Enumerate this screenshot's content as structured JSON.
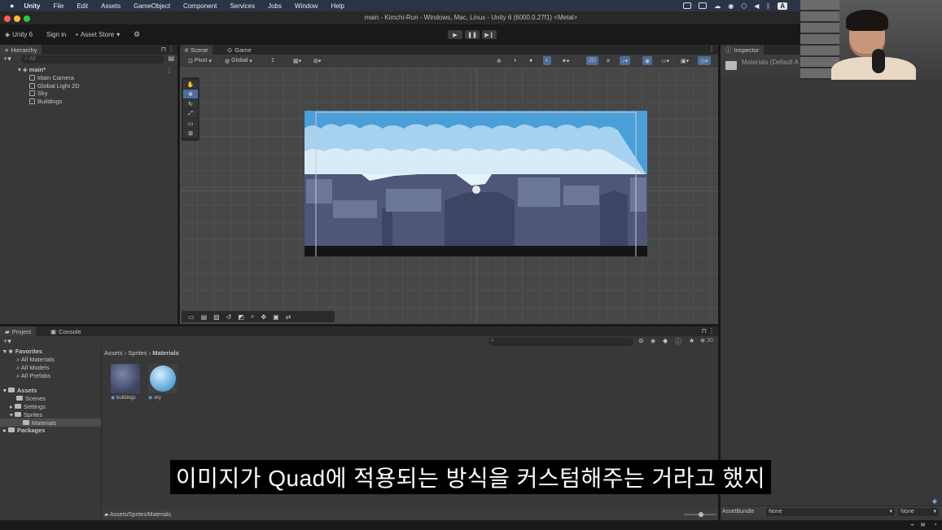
{
  "menubar": {
    "app": "Unity",
    "items": [
      "File",
      "Edit",
      "Assets",
      "GameObject",
      "Component",
      "Services",
      "Jobs",
      "Window",
      "Help"
    ],
    "badge": "A"
  },
  "window": {
    "title": "main - Kimchi-Run - Windows, Mac, Linux - Unity 6 (6000.0.27f1) <Metal>"
  },
  "toolbar": {
    "account": "Unity 6",
    "sign_in": "Sign in",
    "asset_store": "Asset Store",
    "play": "▶",
    "pause": "❚❚",
    "step": "▶❙"
  },
  "hierarchy": {
    "tab": "Hierarchy",
    "search_placeholder": "All",
    "scene": "main*",
    "items": [
      "Main Camera",
      "Global Light 2D",
      "Sky",
      "Buildings"
    ]
  },
  "scene": {
    "tabs": [
      "Scene",
      "Game"
    ],
    "pivot": "Pivot",
    "global": "Global",
    "grid_value": "1",
    "mode_2d": "2D"
  },
  "inspector": {
    "tab": "Inspector",
    "title": "Materials (Default A",
    "assetbundle_label": "AssetBundle",
    "assetbundle_value": "None",
    "variant_value": "None"
  },
  "project": {
    "tabs": [
      "Project",
      "Console"
    ],
    "favorites_label": "Favorites",
    "favorites": [
      "All Materials",
      "All Models",
      "All Prefabs"
    ],
    "assets_label": "Assets",
    "asset_folders": [
      "Scenes",
      "Settings",
      "Sprites",
      "Materials"
    ],
    "packages_label": "Packages",
    "breadcrumb": [
      "Assets",
      "Sprites",
      "Materials"
    ],
    "files": [
      "buildings",
      "sky"
    ],
    "count": "30",
    "path": "Assets/Sprites/Materials"
  },
  "subtitle": "이미지가 Quad에 적용되는 방식을 커스텀해주는 거라고 했지",
  "colors": {
    "sky_top": "#4a9fd8",
    "sky_cloud": "#cfe7f6",
    "buildings": "#4e5679",
    "ground": "#1a1a1a",
    "menubar": "#2b3447"
  }
}
